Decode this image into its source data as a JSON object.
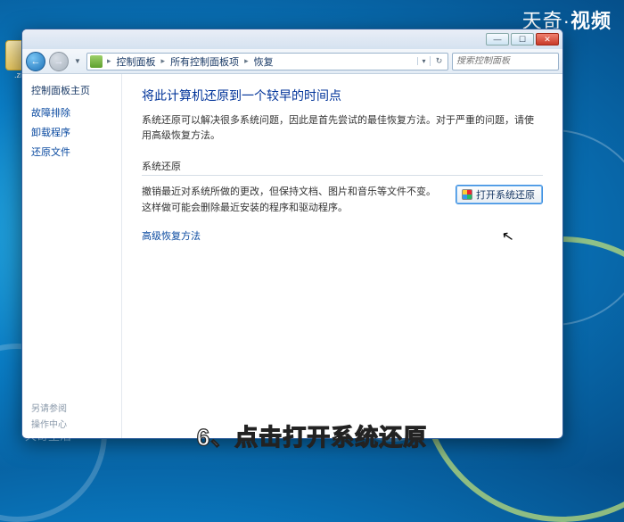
{
  "brand": {
    "left": "天奇",
    "sep": "·",
    "right": "视频"
  },
  "watermark": "天奇生活",
  "desktop": {
    "zip_label": ".zip"
  },
  "caption": "6、点击打开系统还原",
  "window": {
    "controls": {
      "min": "—",
      "max": "☐",
      "close": "✕"
    },
    "nav": {
      "back": "←",
      "forward": "→"
    },
    "breadcrumbs": [
      "控制面板",
      "所有控制面板项",
      "恢复"
    ],
    "search_placeholder": "搜索控制面板"
  },
  "sidebar": {
    "head": "控制面板主页",
    "items": [
      "故障排除",
      "卸载程序",
      "还原文件"
    ],
    "see_also": "另请参阅",
    "action_center": "操作中心"
  },
  "content": {
    "title": "将此计算机还原到一个较早的时间点",
    "desc": "系统还原可以解决很多系统问题，因此是首先尝试的最佳恢复方法。对于严重的问题，请使用高级恢复方法。",
    "group_label": "系统还原",
    "group_text": "撤销最近对系统所做的更改，但保持文档、图片和音乐等文件不变。这样做可能会删除最近安装的程序和驱动程序。",
    "open_btn": "打开系统还原",
    "adv_link": "高级恢复方法"
  }
}
